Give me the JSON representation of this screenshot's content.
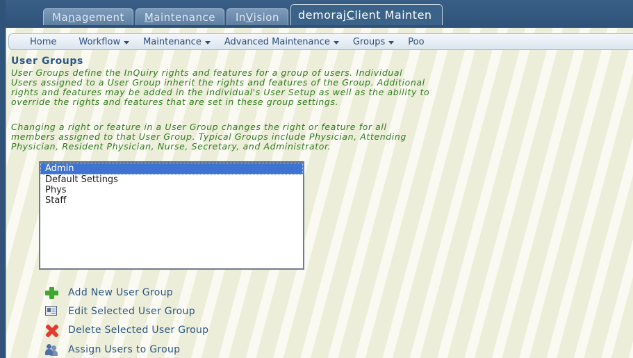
{
  "top_tabs": [
    {
      "pre": "Ma",
      "u": "n",
      "post": "agement"
    },
    {
      "pre": "",
      "u": "M",
      "post": "aintenance"
    },
    {
      "pre": "In",
      "u": "V",
      "post": "ision"
    },
    {
      "pre": "demoraj ",
      "u": "C",
      "post": "lient Mainten"
    }
  ],
  "subnav": {
    "home": "Home",
    "workflow": "Workflow",
    "maintenance": "Maintenance",
    "advanced": "Advanced Maintenance",
    "groups": "Groups",
    "pool": "Poo"
  },
  "page": {
    "title": "User Groups",
    "desc1": [
      "User Groups define the InQuiry rights and features for a group of users. Individual",
      "Users assigned to a User Group inherit the rights and features of the Group. Additional",
      "rights and features may be added in the individual's User Setup as well as the ability to",
      "override the rights and features that are set in these group settings."
    ],
    "desc2": [
      "Changing a right or feature in a User Group changes the right or feature for all",
      "members assigned to that User Group. Typical Groups include Physician, Attending",
      "Physician, Resident Physician, Nurse, Secretary, and Administrator."
    ]
  },
  "groups_list": {
    "options": [
      "Admin",
      "Default Settings",
      "Phys",
      "Staff"
    ],
    "selected": "Admin"
  },
  "actions": {
    "add": "Add New User Group",
    "edit": "Edit Selected User Group",
    "delete": "Delete Selected User Group",
    "assign": "Assign Users to Group"
  },
  "icons": [
    "plus-icon",
    "edit-icon",
    "delete-icon",
    "users-icon"
  ],
  "colors": {
    "frame": "#2f5379",
    "description_text": "#2f7a1c",
    "title_text": "#2a5580",
    "selection": "#3f73d2"
  }
}
